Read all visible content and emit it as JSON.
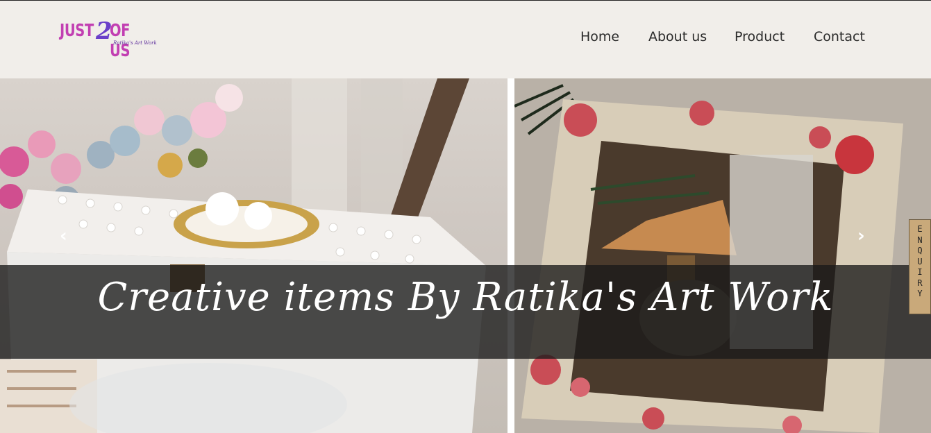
{
  "logo": {
    "word1": "JUST",
    "two": "2",
    "word2": "OF US",
    "tagline": "Ratika's Art Work"
  },
  "nav": {
    "items": [
      {
        "label": "Home"
      },
      {
        "label": "About us"
      },
      {
        "label": "Product"
      },
      {
        "label": "Contact"
      }
    ]
  },
  "hero": {
    "caption": "Creative items By Ratika's Art Work",
    "prev_icon": "chevron-left-icon",
    "next_icon": "chevron-right-icon",
    "prev_glyph": "‹",
    "next_glyph": "›"
  },
  "enquiry": {
    "letters": [
      "E",
      "N",
      "Q",
      "U",
      "I",
      "R",
      "Y"
    ]
  },
  "colors": {
    "background": "#f1eeea",
    "logo_pink": "#c23fb2",
    "logo_purple": "#6a3fc9",
    "nav_text": "#2b2b2b",
    "enquiry_bg": "#c9a97a"
  }
}
